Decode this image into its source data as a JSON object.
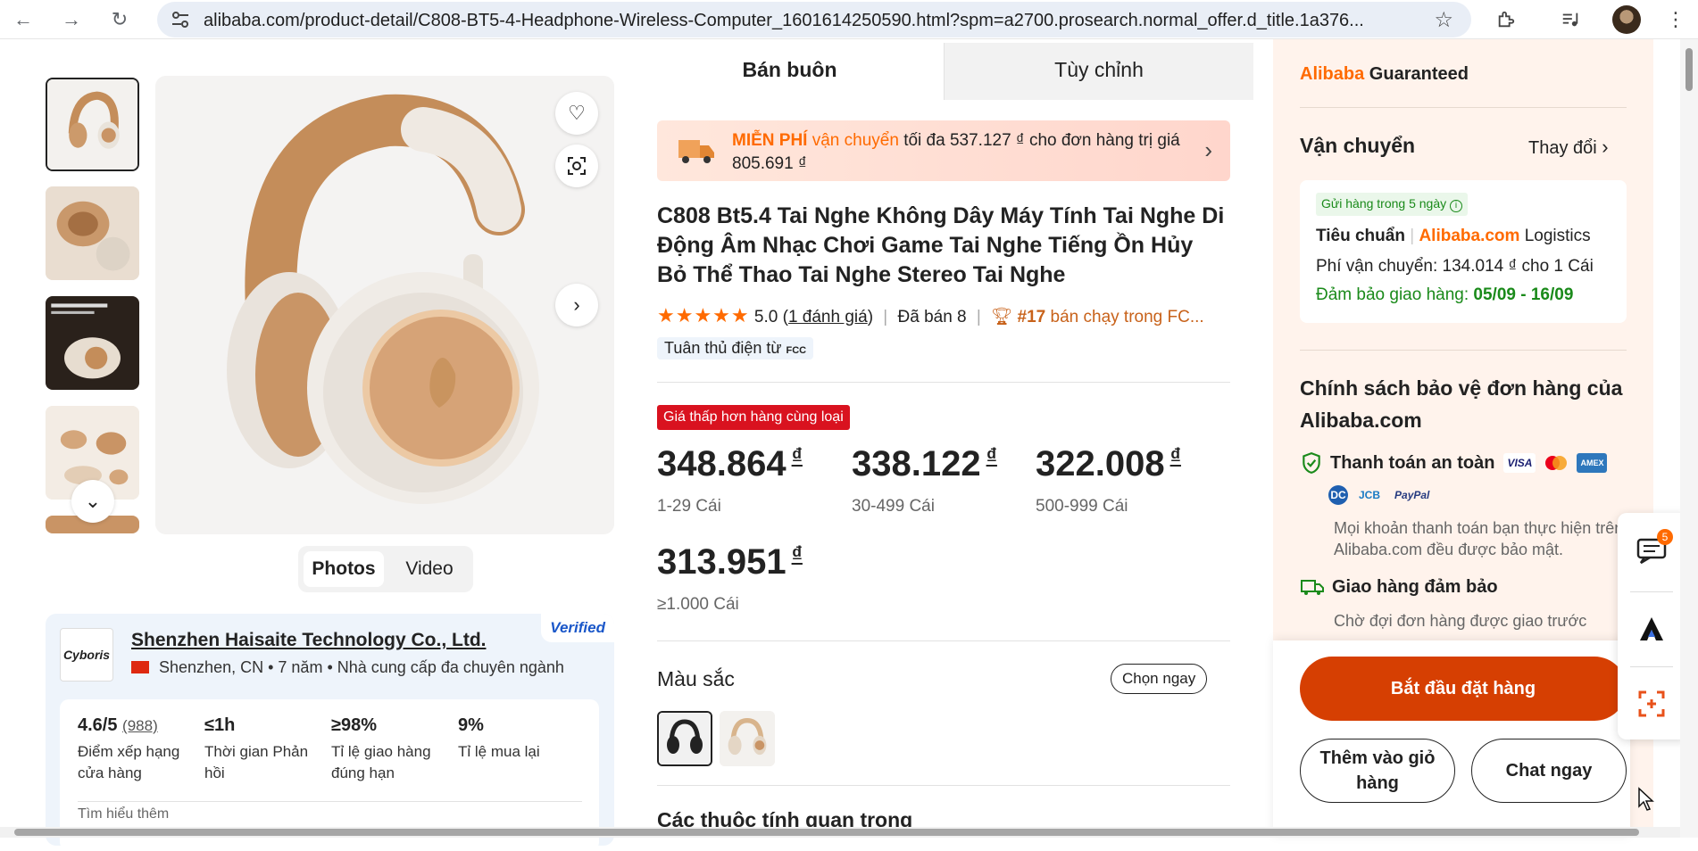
{
  "browser": {
    "url": "alibaba.com/product-detail/C808-BT5-4-Headphone-Wireless-Computer_1601614250590.html?spm=a2700.prosearch.normal_offer.d_title.1a376..."
  },
  "gallery": {
    "media_tabs": [
      "Photos",
      "Video"
    ]
  },
  "supplier": {
    "name": "Shenzhen Haisaite Technology Co., Ltd.",
    "location": "Shenzhen, CN",
    "years": "7 năm",
    "type": "Nhà cung cấp đa chuyên ngành",
    "verified": "Verified",
    "logo_text": "Cyboris",
    "stats": [
      {
        "value": "4.6/5",
        "count": "(988)",
        "label": "Điểm xếp hạng cửa hàng"
      },
      {
        "value": "≤1h",
        "count": "",
        "label": "Thời gian Phản hồi"
      },
      {
        "value": "≥98%",
        "count": "",
        "label": "Tỉ lệ giao hàng đúng hạn"
      },
      {
        "value": "9%",
        "count": "",
        "label": "Tỉ lệ mua lại"
      }
    ],
    "footer_partial": "Tìm hiểu thêm"
  },
  "tabs": {
    "wholesale": "Bán buôn",
    "custom": "Tùy chỉnh"
  },
  "shipping_banner": {
    "free": "MIỄN PHÍ",
    "text1": " vận chuyển",
    "text2": " tối đa 537.127 ₫ cho đơn hàng trị giá 805.691 ₫"
  },
  "product": {
    "title": "C808 Bt5.4 Tai Nghe Không Dây Máy Tính Tai Nghe Di Động Âm Nhạc Chơi Game Tai Nghe Tiếng Ồn Hủy Bỏ Thể Thao Tai Nghe Stereo Tai Nghe",
    "stars": "★★★★★",
    "rating": "5.0",
    "reviews": "1 đánh giá",
    "sold": "Đã bán 8",
    "rank": "#17",
    "rank_text": " bán chạy trong FC...",
    "fcc": "Tuân thủ điện từ",
    "fcc_tag": "FCC",
    "low_price_badge": "Giá thấp hơn hàng cùng loại",
    "currency": "₫",
    "prices": [
      {
        "price": "348.864",
        "qty": "1-29 Cái"
      },
      {
        "price": "338.122",
        "qty": "30-499 Cái"
      },
      {
        "price": "322.008",
        "qty": "500-999 Cái"
      },
      {
        "price": "313.951",
        "qty": "≥1.000 Cái"
      }
    ],
    "color_label": "Màu sắc",
    "choose_now": "Chọn ngay",
    "key_attributes_partial": "Các thuộc tính quan trọng"
  },
  "right": {
    "guaranteed_a": "Alibaba",
    "guaranteed_b": " Guaranteed",
    "shipping_title": "Vận chuyển",
    "change": "Thay đổi",
    "ship_chip": "Gửi hàng trong 5 ngày",
    "standard": "Tiêu chuẩn",
    "logistics_brand": "Alibaba.com",
    "logistics": " Logistics",
    "fee": "Phí vận chuyển: 134.014 ₫ cho 1 Cái",
    "guarantee_label": "Đảm bảo giao hàng: ",
    "guarantee_dates": "05/09 - 16/09",
    "protect_title": "Chính sách bảo vệ đơn hàng của Alibaba.com",
    "safe_pay": "Thanh toán an toàn",
    "pay_icons": [
      "VISA",
      "MC",
      "AMEX",
      "DC",
      "JCB",
      "PayPal"
    ],
    "safe_pay_desc": "Mọi khoản thanh toán bạn thực hiện trên Alibaba.com đều được bảo mật.",
    "delivery": "Giao hàng đảm bảo",
    "delivery_desc": "Chờ đợi đơn hàng được giao trước"
  },
  "cta": {
    "order": "Bắt đầu đặt hàng",
    "cart": "Thêm vào giỏ hàng",
    "chat": "Chat ngay"
  },
  "dock": {
    "messages_badge": "5"
  },
  "colors": {
    "accent": "#ff6a00",
    "order_button": "#d63f02",
    "green": "#1a8a1a",
    "red_badge": "#d9121f"
  }
}
